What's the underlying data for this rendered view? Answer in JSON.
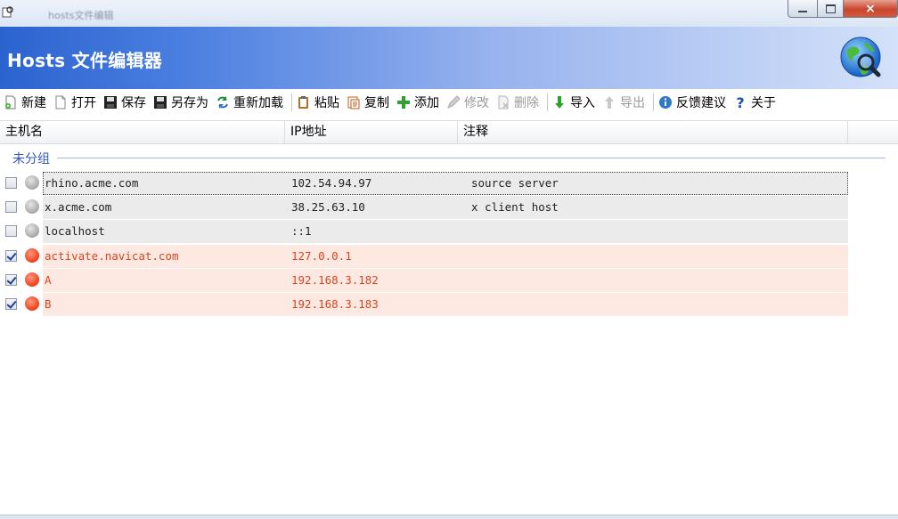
{
  "window": {
    "title": "hosts文件编辑",
    "controls": {
      "minimize": "minimize",
      "maximize": "maximize",
      "close": "×"
    }
  },
  "banner": {
    "title": "Hosts 文件编辑器",
    "logo": "globe-magnifier-icon"
  },
  "toolbar": {
    "items": [
      {
        "id": "new",
        "label": "新建",
        "icon": "new-file-icon",
        "enabled": true
      },
      {
        "id": "open",
        "label": "打开",
        "icon": "open-file-icon",
        "enabled": true
      },
      {
        "id": "save",
        "label": "保存",
        "icon": "save-icon",
        "enabled": true
      },
      {
        "id": "saveas",
        "label": "另存为",
        "icon": "save-as-icon",
        "enabled": true
      },
      {
        "id": "reload",
        "label": "重新加载",
        "icon": "reload-icon",
        "enabled": true
      },
      {
        "id": "paste",
        "label": "粘贴",
        "icon": "paste-icon",
        "enabled": true
      },
      {
        "id": "copy",
        "label": "复制",
        "icon": "copy-icon",
        "enabled": true
      },
      {
        "id": "add",
        "label": "添加",
        "icon": "add-icon",
        "enabled": true
      },
      {
        "id": "edit",
        "label": "修改",
        "icon": "edit-icon",
        "enabled": false
      },
      {
        "id": "delete",
        "label": "删除",
        "icon": "delete-icon",
        "enabled": false
      },
      {
        "id": "import",
        "label": "导入",
        "icon": "import-icon",
        "enabled": true
      },
      {
        "id": "export",
        "label": "导出",
        "icon": "export-icon",
        "enabled": false
      },
      {
        "id": "feedback",
        "label": "反馈建议",
        "icon": "info-icon",
        "enabled": true
      },
      {
        "id": "about",
        "label": "关于",
        "icon": "help-icon",
        "enabled": true
      }
    ]
  },
  "columns": {
    "host": "主机名",
    "ip": "IP地址",
    "note": "注释"
  },
  "group": {
    "label": "未分组"
  },
  "rows": [
    {
      "enabled": false,
      "host": "rhino.acme.com",
      "ip": "102.54.94.97",
      "note": "source server"
    },
    {
      "enabled": false,
      "host": "x.acme.com",
      "ip": "38.25.63.10",
      "note": "x client host"
    },
    {
      "enabled": false,
      "host": "localhost",
      "ip": "::1",
      "note": ""
    },
    {
      "enabled": true,
      "host": "activate.navicat.com",
      "ip": "127.0.0.1",
      "note": ""
    },
    {
      "enabled": true,
      "host": "A",
      "ip": "192.168.3.182",
      "note": ""
    },
    {
      "enabled": true,
      "host": "B",
      "ip": "192.168.3.183",
      "note": ""
    }
  ],
  "colors": {
    "banner_start": "#2b63cf",
    "banner_end": "#d4e1f9",
    "enabled_text": "#d9461d",
    "enabled_bg": "#fde8e2",
    "disabled_bg": "#ebebeb",
    "group_text": "#2f56b8"
  }
}
